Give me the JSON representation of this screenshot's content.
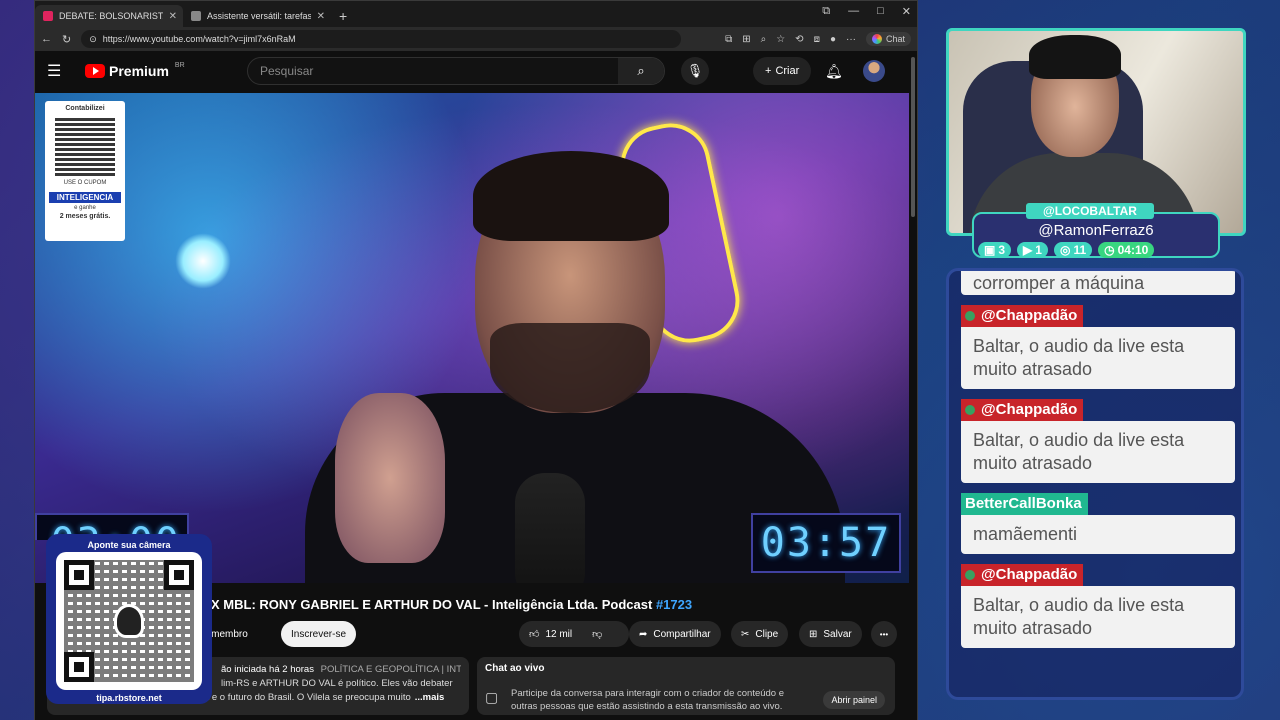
{
  "browser": {
    "tabs": [
      {
        "title": "DEBATE: BOLSONARISTA X MBL",
        "color": "#e0245e",
        "active": true
      },
      {
        "title": "Assistente versátil: tarefas, respostas",
        "color": "#888888",
        "active": false
      }
    ],
    "new_tab": "+",
    "url": "https://www.youtube.com/watch?v=jiml7x6nRaM",
    "chat_label": "Chat",
    "win_controls": {
      "switch": "⧉",
      "minimize": "—",
      "maximize": "□",
      "close": "✕"
    }
  },
  "youtube": {
    "logo_text": "Premium",
    "region": "BR",
    "search_placeholder": "Pesquisar",
    "create_label": "Criar",
    "video": {
      "qr_card": {
        "top": "Contabilizei",
        "small": "USE O CUPOM",
        "brand": "INTELIGENCIA",
        "line1": "e ganhe",
        "line2": "2 meses grátis."
      },
      "timer_left": "03:00",
      "timer_right": "03:57"
    },
    "title_visible": "X MBL: RONY GABRIEL E ARTHUR DO VAL - Inteligência Ltda. Podcast",
    "title_tag": "#1723",
    "actions": {
      "join": "eja membro",
      "subscribe": "Inscrever-se",
      "likes": "12 mil",
      "share": "Compartilhar",
      "clip": "Clipe",
      "save": "Salvar",
      "more": "•••"
    },
    "description": {
      "meta": "ão iniciada há 2 horas",
      "tags": "POLÍTICA E GEOPOLÍTICA | INTE",
      "line2": "lim-RS e ARTHUR DO VAL é político. Eles vão debater",
      "line3": "sobre Bolsonaro, a política de direita e o futuro do Brasil. O Vilela se preocupa muito",
      "more": "...mais"
    },
    "live_chat": {
      "header": "Chat ao vivo",
      "prompt": "Participe da conversa para interagir com o criador de conteúdo e outras pessoas que estão assistindo a esta transmissão ao vivo.",
      "open_button": "Abrir painel"
    }
  },
  "overlay_qr": {
    "top": "Aponte sua câmera",
    "url": "tipa.rbstore.net"
  },
  "streamer": {
    "handle_top": "@LOCOBALTAR",
    "handle_name": "@RamonFerraz6",
    "stats": [
      {
        "icon": "chat-icon",
        "value": "3"
      },
      {
        "icon": "video-icon",
        "value": "1"
      },
      {
        "icon": "viewers-icon",
        "value": "11"
      },
      {
        "icon": "clock-icon",
        "value": "04:10"
      }
    ]
  },
  "chat": {
    "partial_text": "corromper a máquina",
    "messages": [
      {
        "user": "@Chappadão",
        "text": "Baltar, o audio da live esta muito atrasado",
        "color": "red"
      },
      {
        "user": "@Chappadão",
        "text": "Baltar, o audio da live esta muito atrasado",
        "color": "red"
      },
      {
        "user": "BetterCallBonka",
        "text": "mamãementi",
        "color": "green"
      },
      {
        "user": "@Chappadão",
        "text": "Baltar, o audio da live esta muito atrasado",
        "color": "red"
      }
    ]
  }
}
